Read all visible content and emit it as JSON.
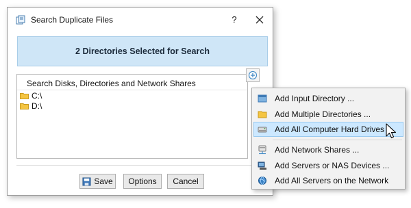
{
  "dialog": {
    "title": "Search Duplicate Files",
    "help_label": "?",
    "banner_text": "2 Directories Selected for Search",
    "list_header": "Search Disks, Directories and Network Shares",
    "directories": [
      "C:\\",
      "D:\\"
    ],
    "buttons": {
      "save": "Save",
      "options": "Options",
      "cancel": "Cancel"
    }
  },
  "menu": {
    "items": [
      {
        "label": "Add Input Directory ...",
        "icon": "directory-icon"
      },
      {
        "label": "Add Multiple Directories ...",
        "icon": "folder-icon"
      },
      {
        "label": "Add All Computer Hard Drives",
        "icon": "hard-drive-icon"
      },
      {
        "label": "Add Network Shares ...",
        "icon": "network-share-icon"
      },
      {
        "label": "Add Servers or NAS Devices ...",
        "icon": "server-icon"
      },
      {
        "label": "Add All Servers on the Network",
        "icon": "globe-icon"
      }
    ]
  },
  "colors": {
    "banner_bg": "#cfe6f7",
    "highlight_bg": "#cce8ff",
    "folder_yellow": "#f5c542"
  }
}
